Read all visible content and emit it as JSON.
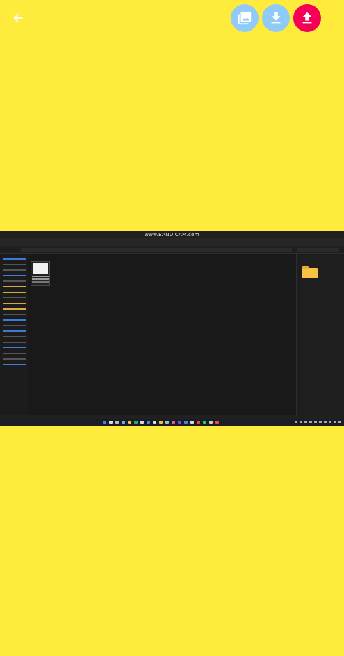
{
  "toolbar": {
    "back_icon": "arrow-back-icon",
    "actions": [
      {
        "icon": "photo-library-icon",
        "color": "#90CAF9"
      },
      {
        "icon": "download-icon",
        "color": "#90CAF9"
      },
      {
        "icon": "upload-icon",
        "color": "#F50057"
      }
    ]
  },
  "colors": {
    "background": "#FFEB3B"
  },
  "preview": {
    "watermark": "www.BANDICAM.com"
  }
}
